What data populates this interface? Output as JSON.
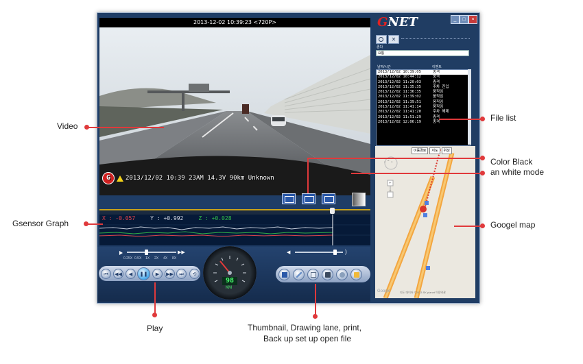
{
  "video": {
    "title_bar": "2013-12-02 10:39:23 <720P>",
    "osd_logo": "G",
    "osd_text": "2013/12/02  10:39  23AM  14.3V    90km  Unknown"
  },
  "gsensor": {
    "x_label": "X : -0.057",
    "y_label": "Y : +0.992",
    "z_label": "Z : +0.028",
    "x_color": "#e8434b",
    "y_color": "#d8dde8",
    "z_color": "#33c24a"
  },
  "playback": {
    "speed_labels": [
      "0.25X",
      "0.5X",
      "1X",
      "2X",
      "4X",
      "8X"
    ]
  },
  "speedometer": {
    "speed_value": "98",
    "unit": "KM"
  },
  "brand": {
    "letter": "G",
    "rest": "NET"
  },
  "window_controls": {
    "minimize": "_",
    "maximize": "□",
    "close": "×"
  },
  "panel": {
    "filter_label": "종다",
    "search_value": "요통",
    "col_datetime": "날짜/시간",
    "col_event": "이벤트",
    "files": [
      {
        "datetime": "2013/12/02 10:39:05",
        "event": "충격"
      },
      {
        "datetime": "2013/12/02 10:44:12",
        "event": "충격"
      },
      {
        "datetime": "2013/12/02 11:20:03",
        "event": "충격"
      },
      {
        "datetime": "2013/12/02 11:35:35",
        "event": "주차 진입"
      },
      {
        "datetime": "2013/12/02 11:36:35",
        "event": "움직임"
      },
      {
        "datetime": "2013/12/02 11:39:02",
        "event": "움직임"
      },
      {
        "datetime": "2013/12/02 11:39:51",
        "event": "움직임"
      },
      {
        "datetime": "2013/12/02 11:41:14",
        "event": "움직임"
      },
      {
        "datetime": "2013/12/02 11:41:20",
        "event": "주차 해제"
      },
      {
        "datetime": "2013/12/02 11:51:29",
        "event": "충격"
      },
      {
        "datetime": "2013/12/02 12:06:19",
        "event": "충격"
      }
    ],
    "map_option_1": "이동경로",
    "map_option_2": "지도",
    "map_option_3": "위성",
    "map_footer": "지도 데이터 ©2013 SK planet   이용약관",
    "map_watermark": "Google"
  },
  "callouts": {
    "video": "Video",
    "gsensor": "Gsensor Graph",
    "play": "Play",
    "file_list": "File list",
    "color_mode_line1": "Color Black",
    "color_mode_line2": "an white mode",
    "map": "Googel map",
    "tools_line1": "Thumbnail, Drawing lane, print,",
    "tools_line2": "Back up set up open file"
  },
  "colors": {
    "callout_red": "#e0393b",
    "app_blue": "#1f3d66",
    "route_orange": "#f3a640"
  }
}
